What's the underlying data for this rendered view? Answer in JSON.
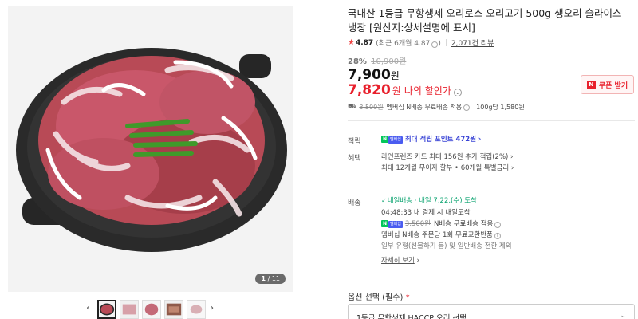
{
  "gallery": {
    "counter_current": "1",
    "counter_total": "/ 11",
    "prev_arrow": "‹",
    "next_arrow": "›",
    "thumbnail_count": 5
  },
  "product": {
    "title": "국내산 1등급 무항생제 오리로스 오리고기 500g 생오리 슬라이스 냉장 [원산지:상세설명에 표시]",
    "rating": "4.87",
    "rating_recent": "(최근 6개월 4.87",
    "rating_recent_close": ")",
    "review_count": "2,071건 리뷰",
    "discount_rate": "28%",
    "original_price": "10,900원",
    "price": "7,900",
    "price_unit": "원",
    "my_price": "7,820",
    "my_price_unit": "원",
    "my_price_label": "나의 할인가",
    "coupon_button": "쿠폰 받기"
  },
  "shipping_summary": {
    "old_fee": "3,500원",
    "text": "멤버십 N배송 무료배송 적용",
    "unit_price": "100g당 1,580원"
  },
  "points": {
    "label": "적립",
    "badge": "N",
    "membership_badge": "멤버십",
    "text": "최대 적립 포인트 472원",
    "chevron": "›"
  },
  "benefits": {
    "label": "혜택",
    "line1": "라인프렌즈 카드 최대 156원 추가 적립(2%)",
    "line2": "최대 12개월 무이자 할부 • 60개월 특별금리",
    "chevron": "›"
  },
  "delivery": {
    "label": "배송",
    "tag": "내일배송",
    "arrival": "· 내일 7.22.(수) 도착",
    "countdown": "04:48:33",
    "countdown_text": "내 결제 시 내일도착",
    "old_fee": "3,500원",
    "free_text": "N배송 무료배송 적용",
    "exchange_text": "멤버십 N배송 주문당 1회 무료교환반품",
    "exclude_text": "일부 유형(선물하기 등) 및 일반배송 전환 제외",
    "more_link": "자세히 보기"
  },
  "option": {
    "label": "옵션 선택 (필수)",
    "required_mark": "*",
    "selected": "1등급 무항생제 HACCP 오리 선택",
    "chevron": "⌄"
  },
  "colors": {
    "accent_red": "#e8202c",
    "npay_green": "#03c75a",
    "point_blue": "#3a45d6",
    "delivery_green": "#0aa36f"
  }
}
